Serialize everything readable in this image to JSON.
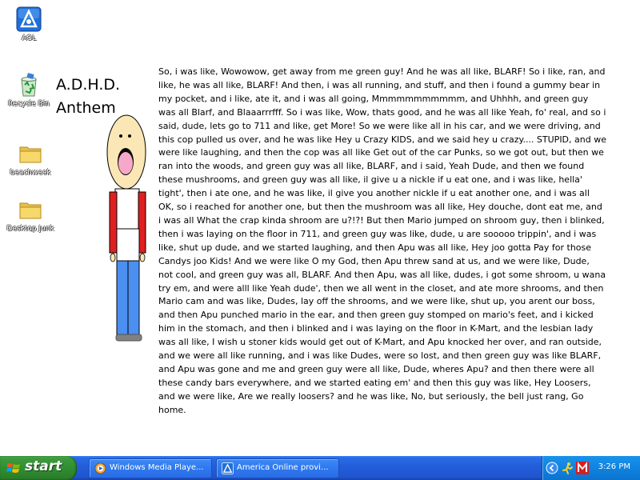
{
  "desktop": {
    "icons": [
      {
        "label": "AOL",
        "icon": "aol-icon"
      },
      {
        "label": "Recycle Bin",
        "icon": "recycle-bin-icon"
      },
      {
        "label": "beachweek",
        "icon": "folder-icon"
      },
      {
        "label": "Desktop Junk",
        "icon": "folder-icon"
      }
    ],
    "title_line1": "A.D.H.D.",
    "title_line2": "Anthem",
    "story": "So, i was like, Wowowow, get away from me green guy! And he was all like, BLARF! So i like, ran, and like, he was all like, BLARF! And then, i was all running, and stuff, and then i found a gummy bear in my pocket, and i like, ate it, and i was all going, Mmmmmmmmmmm, and Uhhhh, and green guy was all Blarf, and Blaaarrrfff. So i was like, Wow, thats good, and he was all like Yeah, fo' real, and so i said, dude, lets go to 711 and like, get More! So we were like all in his car, and we were driving, and this cop pulled us over, and he was like Hey u Crazy KIDS, and we said hey u crazy.... STUPID, and we were like laughing, and then the cop was all like Get out of the car Punks, so we got out, but then we ran into the woods, and green guy was all like, BLARF, and i said, Yeah Dude, and then we found these mushrooms, and green guy was all like, il give u a nickle if u eat one, and i was like, hella' tight', then i ate one, and he was like, il give you another nickle if u eat another one, and i was all OK, so i reached for another one, but then the mushroom was all like, Hey douche, dont eat me, and i was all What the crap kinda shroom are u?!?!  But then Mario jumped on shroom guy, then i blinked, then i was laying on the floor in 711, and green guy was like, dude, u are sooooo trippin', and i was like, shut up dude, and we started laughing, and then Apu was all like, Hey joo gotta Pay for those Candys joo Kids! And we were like O my God, then Apu threw sand at us, and we were like, Dude, not cool, and green guy was all, BLARF. And then Apu, was all like, dudes, i got some shroom, u wana try em, and were alll like Yeah dude', then we all went in the closet, and ate more shrooms, and then Mario cam and was like, Dudes, lay off the shrooms, and we were like, shut up, you arent our boss, and then Apu punched mario in the ear, and then green guy stomped on mario's feet, and i kicked him in the stomach, and then i blinked and i was laying on the floor in K-Mart, and the lesbian lady was all like, I wish u stoner kids would get out of K-Mart, and Apu knocked her over, and ran outside, and we were all like running, and i was like Dudes, were so lost, and then green guy was like BLARF, and Apu was gone and me and green guy were all like, Dude, wheres Apu? and then there were all these candy bars everywhere, and we started eating em' and then this guy was like, Hey Loosers, and we were like, Are we really loosers? and he was like, No, but seriously, the bell just rang, Go home."
  },
  "taskbar": {
    "start_label": "start",
    "tasks": [
      {
        "label": "Windows Media Playe...",
        "icon": "windows-media-player-icon"
      },
      {
        "label": "America  Online provi...",
        "icon": "aol-icon"
      }
    ],
    "tray_icons": [
      "expand-tray-icon",
      "aim-running-man-icon",
      "mcafee-m-icon"
    ],
    "clock": "3:26 PM"
  },
  "colors": {
    "taskbar": "#245edb",
    "start_green": "#3c9a3c",
    "tray": "#0f84e0",
    "shirt_red": "#e02020",
    "pants_blue": "#4b8ff0",
    "mouth_pink": "#f7a8c8"
  }
}
